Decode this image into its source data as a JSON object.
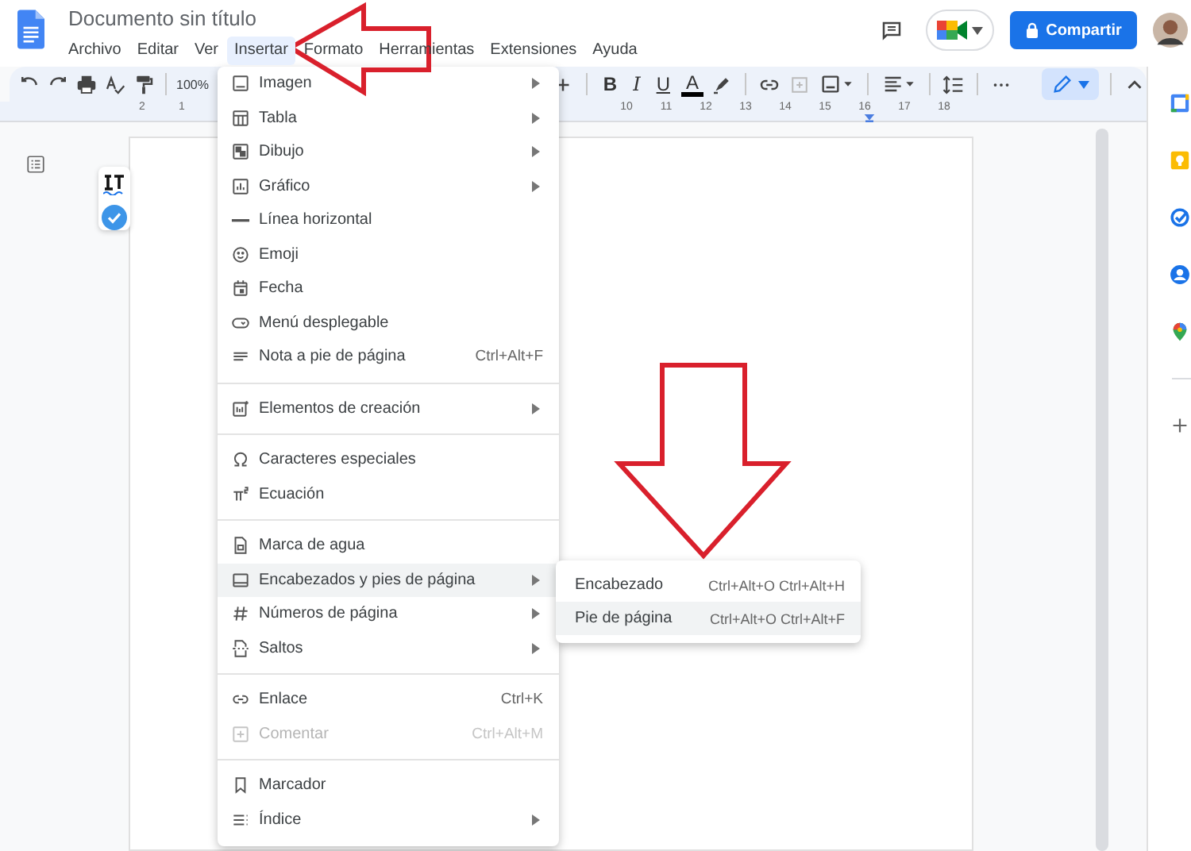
{
  "document": {
    "title": "Documento sin título"
  },
  "menubar": [
    {
      "label": "Archivo",
      "selected": false
    },
    {
      "label": "Editar",
      "selected": false
    },
    {
      "label": "Ver",
      "selected": false
    },
    {
      "label": "Insertar",
      "selected": true
    },
    {
      "label": "Formato",
      "selected": false
    },
    {
      "label": "Herramientas",
      "selected": false
    },
    {
      "label": "Extensiones",
      "selected": false
    },
    {
      "label": "Ayuda",
      "selected": false
    }
  ],
  "share_button": {
    "label": "Compartir"
  },
  "toolbar": {
    "zoom": "100%",
    "format_buttons": [
      "B",
      "I",
      "U",
      "A"
    ]
  },
  "ruler": {
    "left_labels": [
      "2",
      "1"
    ],
    "right_labels": [
      "10",
      "11",
      "12",
      "13",
      "14",
      "15",
      "16",
      "17",
      "18"
    ]
  },
  "insert_menu": {
    "sections": [
      [
        {
          "label": "Imagen",
          "submenu": true,
          "selected": false,
          "disabled": false
        },
        {
          "label": "Tabla",
          "submenu": true,
          "selected": false,
          "disabled": false
        },
        {
          "label": "Dibujo",
          "submenu": true,
          "selected": false,
          "disabled": false
        },
        {
          "label": "Gráfico",
          "submenu": true,
          "selected": false,
          "disabled": false
        },
        {
          "label": "Línea horizontal",
          "submenu": false,
          "selected": false,
          "disabled": false
        },
        {
          "label": "Emoji",
          "submenu": false,
          "selected": false,
          "disabled": false
        },
        {
          "label": "Fecha",
          "submenu": false,
          "selected": false,
          "disabled": false
        },
        {
          "label": "Menú desplegable",
          "submenu": false,
          "selected": false,
          "disabled": false
        },
        {
          "label": "Nota a pie de página",
          "shortcut": "Ctrl+Alt+F",
          "submenu": false,
          "selected": false,
          "disabled": false
        }
      ],
      [
        {
          "label": "Elementos de creación",
          "submenu": true,
          "selected": false,
          "disabled": false
        }
      ],
      [
        {
          "label": "Caracteres especiales",
          "submenu": false,
          "selected": false,
          "disabled": false
        },
        {
          "label": "Ecuación",
          "submenu": false,
          "selected": false,
          "disabled": false
        }
      ],
      [
        {
          "label": "Marca de agua",
          "submenu": false,
          "selected": false,
          "disabled": false
        },
        {
          "label": "Encabezados y pies de página",
          "submenu": true,
          "selected": true,
          "disabled": false
        },
        {
          "label": "Números de página",
          "submenu": true,
          "selected": false,
          "disabled": false
        },
        {
          "label": "Saltos",
          "submenu": true,
          "selected": false,
          "disabled": false
        }
      ],
      [
        {
          "label": "Enlace",
          "shortcut": "Ctrl+K",
          "submenu": false,
          "selected": false,
          "disabled": false
        },
        {
          "label": "Comentar",
          "shortcut": "Ctrl+Alt+M",
          "submenu": false,
          "selected": false,
          "disabled": true
        }
      ],
      [
        {
          "label": "Marcador",
          "submenu": false,
          "selected": false,
          "disabled": false
        },
        {
          "label": "Índice",
          "submenu": true,
          "selected": false,
          "disabled": false
        }
      ]
    ]
  },
  "submenu": {
    "items": [
      {
        "label": "Encabezado",
        "shortcut": "Ctrl+Alt+O Ctrl+Alt+H",
        "selected": false
      },
      {
        "label": "Pie de página",
        "shortcut": "Ctrl+Alt+O Ctrl+Alt+F",
        "selected": true
      }
    ]
  }
}
